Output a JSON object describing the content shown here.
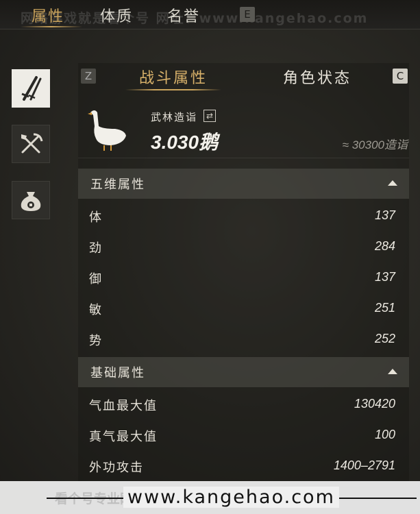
{
  "watermark_top": "网络游戏就是看个号 网址：www.kangehao.com",
  "top_tabs": [
    {
      "label": "属性",
      "active": true
    },
    {
      "label": "体质",
      "active": false
    },
    {
      "label": "名誉",
      "active": false
    }
  ],
  "top_tab_key": "E",
  "side_icons": [
    "weapon-swords-icon",
    "tools-shovel-pickaxe-icon",
    "money-bag-icon"
  ],
  "subtab_key_left": "Z",
  "subtab_key_right": "C",
  "subtabs": [
    {
      "label": "战斗属性",
      "active": true
    },
    {
      "label": "角色状态",
      "active": false
    }
  ],
  "summary": {
    "label": "武林造诣",
    "value": "3.030鹅",
    "approx": "≈ 30300造诣"
  },
  "sections": [
    {
      "title": "五维属性",
      "stats": [
        {
          "name": "体",
          "value": "137"
        },
        {
          "name": "劲",
          "value": "284"
        },
        {
          "name": "御",
          "value": "137"
        },
        {
          "name": "敏",
          "value": "251"
        },
        {
          "name": "势",
          "value": "252"
        }
      ]
    },
    {
      "title": "基础属性",
      "stats": [
        {
          "name": "气血最大值",
          "value": "130420"
        },
        {
          "name": "真气最大值",
          "value": "100"
        },
        {
          "name": "外功攻击",
          "value": "1400–2791"
        }
      ]
    }
  ],
  "bottom_watermark": {
    "url": "www.kangehao.com",
    "ghost": "看个号专业网络游戏账号交易平台"
  },
  "colors": {
    "accent": "#c9a35c",
    "text": "#e6e2d8",
    "section_bg": "#5a5a55"
  }
}
